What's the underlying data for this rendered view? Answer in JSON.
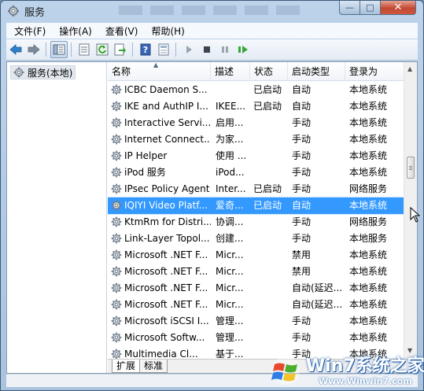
{
  "window": {
    "title": "服务",
    "minimize_glyph": "—",
    "maximize_glyph": "□",
    "close_glyph": "✕"
  },
  "menu": [
    "文件(F)",
    "操作(A)",
    "查看(V)",
    "帮助(H)"
  ],
  "toolbar_icons": [
    "back-arrow-icon",
    "forward-arrow-icon",
    "show-tree-icon",
    "properties-icon",
    "refresh-icon",
    "export-list-icon",
    "help-icon",
    "view-icon",
    "start-service-icon",
    "stop-service-icon",
    "pause-service-icon",
    "restart-service-icon"
  ],
  "tree": {
    "root_label": "服务(本地)"
  },
  "columns": [
    "名称",
    "描述",
    "状态",
    "启动类型",
    "登录为"
  ],
  "services": [
    {
      "name": "ICBC Daemon S...",
      "desc": "",
      "status": "已启动",
      "startup": "自动",
      "logon": "本地系统"
    },
    {
      "name": "IKE and AuthIP I...",
      "desc": "IKEE...",
      "status": "已启动",
      "startup": "自动",
      "logon": "本地系统"
    },
    {
      "name": "Interactive Servi...",
      "desc": "启用...",
      "status": "",
      "startup": "手动",
      "logon": "本地系统"
    },
    {
      "name": "Internet Connect...",
      "desc": "为家...",
      "status": "",
      "startup": "手动",
      "logon": "本地系统"
    },
    {
      "name": "IP Helper",
      "desc": "使用 ...",
      "status": "",
      "startup": "手动",
      "logon": "本地系统"
    },
    {
      "name": "iPod 服务",
      "desc": "iPod...",
      "status": "",
      "startup": "手动",
      "logon": "本地系统"
    },
    {
      "name": "IPsec Policy Agent",
      "desc": "Inter...",
      "status": "已启动",
      "startup": "手动",
      "logon": "网络服务"
    },
    {
      "name": "IQIYI Video Platf...",
      "desc": "爱奇...",
      "status": "已启动",
      "startup": "自动",
      "logon": "本地系统"
    },
    {
      "name": "KtmRm for Distri...",
      "desc": "协调...",
      "status": "",
      "startup": "手动",
      "logon": "网络服务"
    },
    {
      "name": "Link-Layer Topol...",
      "desc": "创建...",
      "status": "",
      "startup": "手动",
      "logon": "本地服务"
    },
    {
      "name": "Microsoft .NET F...",
      "desc": "Micr...",
      "status": "",
      "startup": "禁用",
      "logon": "本地系统"
    },
    {
      "name": "Microsoft .NET F...",
      "desc": "Micr...",
      "status": "",
      "startup": "禁用",
      "logon": "本地系统"
    },
    {
      "name": "Microsoft .NET F...",
      "desc": "Micr...",
      "status": "",
      "startup": "自动(延迟...",
      "logon": "本地系统"
    },
    {
      "name": "Microsoft .NET F...",
      "desc": "Micr...",
      "status": "",
      "startup": "自动(延迟...",
      "logon": "本地系统"
    },
    {
      "name": "Microsoft iSCSI I...",
      "desc": "管理...",
      "status": "",
      "startup": "手动",
      "logon": "本地系统"
    },
    {
      "name": "Microsoft Softw...",
      "desc": "管理...",
      "status": "",
      "startup": "手动",
      "logon": "本地系统"
    },
    {
      "name": "Multimedia Cl...",
      "desc": "基于...",
      "status": "",
      "startup": "手动",
      "logon": "本地系统"
    }
  ],
  "selected_index": 7,
  "tabs": [
    "扩展",
    "标准"
  ],
  "watermark": {
    "text": "Win7系统之家",
    "url": "Www.Winwin7.com"
  },
  "colors": {
    "selection": "#3399ff",
    "title_bar": "#bcd3ea",
    "close_button": "#c24a33"
  }
}
